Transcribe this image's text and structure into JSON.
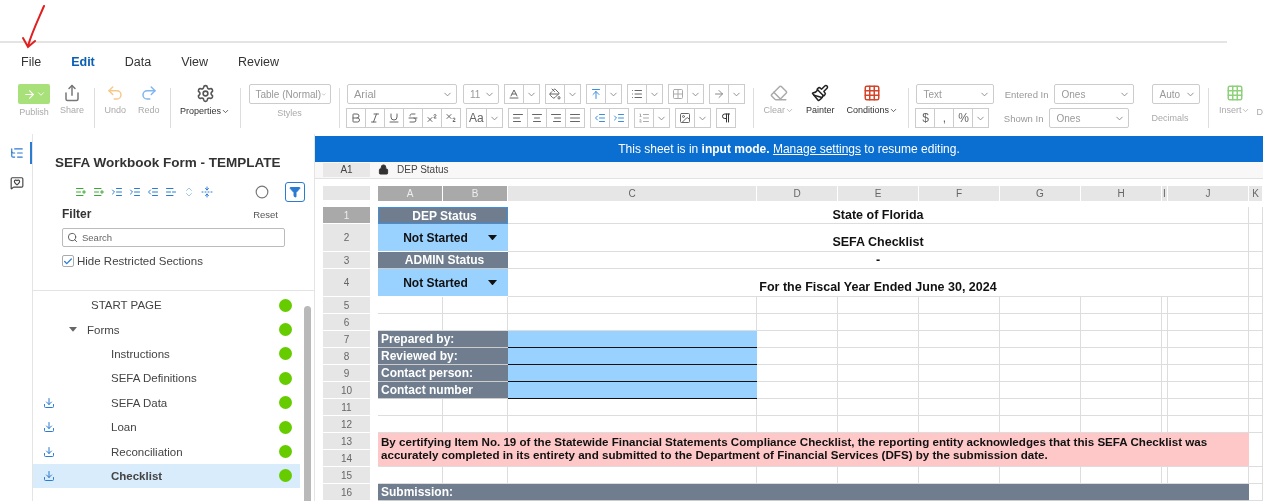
{
  "menu": [
    {
      "label": "File",
      "selected": false
    },
    {
      "label": "Edit",
      "selected": true
    },
    {
      "label": "Data",
      "selected": false
    },
    {
      "label": "View",
      "selected": false
    },
    {
      "label": "Review",
      "selected": false
    }
  ],
  "toolbar": {
    "actions": [
      {
        "kind": "publish",
        "label": "Publish",
        "disabled": true
      },
      {
        "kind": "share",
        "label": "Share",
        "disabled": true
      },
      {
        "kind": "undo",
        "label": "Undo",
        "disabled": true
      },
      {
        "kind": "redo",
        "label": "Redo",
        "disabled": true
      },
      {
        "kind": "properties",
        "label": "Properties",
        "disabled": false
      }
    ],
    "style_select": {
      "value": "Table (Normal)",
      "caption": "Styles"
    },
    "font": {
      "family": "Arial",
      "size": "11",
      "case_button": "Aa"
    },
    "format_actions": [
      {
        "kind": "clear",
        "label": "Clear",
        "disabled": true
      },
      {
        "kind": "painter",
        "label": "Painter",
        "disabled": false
      },
      {
        "kind": "conditions",
        "label": "Conditions",
        "disabled": false
      }
    ],
    "number": {
      "format": "Text",
      "entered_label": "Entered In",
      "entered": "Ones",
      "shown_label": "Shown In",
      "shown": "Ones",
      "currency_buttons": [
        "$",
        ",",
        "%"
      ],
      "decimals": "Auto",
      "decimals_caption": "Decimals"
    },
    "insert": {
      "label": "Insert",
      "disabled": true
    },
    "cut_label": "D"
  },
  "rail": [
    {
      "kind": "outline",
      "selected": true
    },
    {
      "kind": "comments",
      "selected": false
    }
  ],
  "sidebar": {
    "title": "SEFA Workbook Form - TEMPLATE",
    "filter_active": true,
    "filter_label": "Filter",
    "reset": "Reset",
    "search": {
      "placeholder": "Search"
    },
    "hide_restricted": {
      "label": "Hide Restricted Sections",
      "checked": true
    },
    "items": [
      {
        "label": "START PAGE",
        "kind": "plain",
        "color": "#66cc00",
        "selected": false
      },
      {
        "label": "Forms",
        "kind": "plain",
        "color": "#66cc00",
        "selected": false,
        "expanded": true,
        "children": [
          {
            "label": "Instructions",
            "kind": "plain",
            "color": "#66cc00",
            "selected": false
          },
          {
            "label": "SEFA Definitions",
            "kind": "plain",
            "color": "#66cc00",
            "selected": false
          },
          {
            "label": "SEFA Data",
            "kind": "import",
            "color": "#66cc00",
            "selected": false
          },
          {
            "label": "Loan",
            "kind": "import",
            "color": "#66cc00",
            "selected": false
          },
          {
            "label": "Reconciliation",
            "kind": "import",
            "color": "#66cc00",
            "selected": false
          },
          {
            "label": "Checklist",
            "kind": "import",
            "color": "#66cc00",
            "selected": true
          }
        ]
      }
    ]
  },
  "banner": {
    "text": "This sheet is in **input mode.**",
    "link": "Manage settings",
    "after": "to resume editing."
  },
  "formula_bar": {
    "cell": "A1",
    "locked": true,
    "value": "DEP Status"
  },
  "sheet": {
    "columns": [
      {
        "label": "A",
        "selected": true
      },
      {
        "label": "B",
        "selected": true
      },
      {
        "label": "C",
        "selected": false
      },
      {
        "label": "D",
        "selected": false
      },
      {
        "label": "E",
        "selected": false
      },
      {
        "label": "F",
        "selected": false
      },
      {
        "label": "G",
        "selected": false
      },
      {
        "label": "H",
        "selected": false
      },
      {
        "label": "I",
        "selected": false
      },
      {
        "label": "J",
        "selected": false
      },
      {
        "label": "K",
        "selected": false
      }
    ],
    "rows": [
      {
        "numbers": [
          "1"
        ],
        "kind": "status_label",
        "label": "DEP Status",
        "title": "State of Florida",
        "selected": true
      },
      {
        "numbers": [
          "2"
        ],
        "kind": "status_select",
        "value": "Not Started",
        "title": "SEFA Checklist",
        "selected": false
      },
      {
        "numbers": [
          "3"
        ],
        "kind": "status_label",
        "label": "ADMIN Status",
        "title": "-",
        "selected": false
      },
      {
        "numbers": [
          "4"
        ],
        "kind": "status_select",
        "value": "Not Started",
        "title": "For the Fiscal Year Ended June 30, 2024",
        "selected": false
      },
      {
        "numbers": [
          "5"
        ],
        "kind": "blank",
        "selected": false
      },
      {
        "numbers": [
          "6"
        ],
        "kind": "blank",
        "selected": false
      },
      {
        "numbers": [
          "7"
        ],
        "kind": "field",
        "label": "Prepared by:",
        "selected": false
      },
      {
        "numbers": [
          "8"
        ],
        "kind": "field",
        "label": "Reviewed by:",
        "selected": false
      },
      {
        "numbers": [
          "9"
        ],
        "kind": "field",
        "label": "Contact person:",
        "selected": false
      },
      {
        "numbers": [
          "10"
        ],
        "kind": "field",
        "label": "Contact number",
        "selected": false
      },
      {
        "numbers": [
          "11"
        ],
        "kind": "blank",
        "selected": false
      },
      {
        "numbers": [
          "12"
        ],
        "kind": "blank",
        "selected": false
      },
      {
        "numbers": [
          "13",
          "14"
        ],
        "kind": "note",
        "text": "By certifying Item No. 19 of the Statewide Financial Statements Compliance Checklist, the reporting entity acknowledges that this SEFA Checklist was accurately completed in its entirety and submitted to the Department of Financial Services (DFS) by the submission date.",
        "selected": false
      },
      {
        "numbers": [
          "15"
        ],
        "kind": "blank",
        "selected": false
      },
      {
        "numbers": [
          "16"
        ],
        "kind": "section",
        "label": "Submission:",
        "selected": false
      }
    ]
  }
}
